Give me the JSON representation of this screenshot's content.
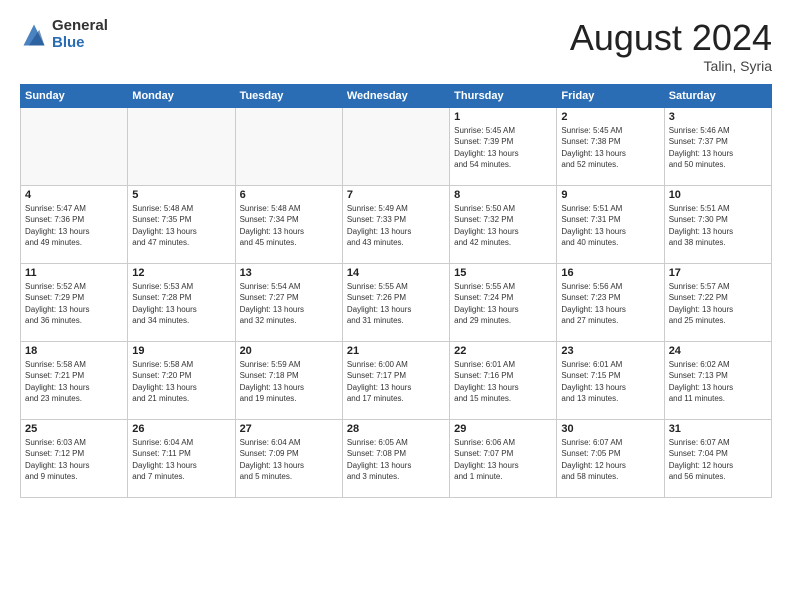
{
  "header": {
    "logo_general": "General",
    "logo_blue": "Blue",
    "month_title": "August 2024",
    "location": "Talin, Syria"
  },
  "weekdays": [
    "Sunday",
    "Monday",
    "Tuesday",
    "Wednesday",
    "Thursday",
    "Friday",
    "Saturday"
  ],
  "weeks": [
    [
      {
        "day": "",
        "info": ""
      },
      {
        "day": "",
        "info": ""
      },
      {
        "day": "",
        "info": ""
      },
      {
        "day": "",
        "info": ""
      },
      {
        "day": "1",
        "info": "Sunrise: 5:45 AM\nSunset: 7:39 PM\nDaylight: 13 hours\nand 54 minutes."
      },
      {
        "day": "2",
        "info": "Sunrise: 5:45 AM\nSunset: 7:38 PM\nDaylight: 13 hours\nand 52 minutes."
      },
      {
        "day": "3",
        "info": "Sunrise: 5:46 AM\nSunset: 7:37 PM\nDaylight: 13 hours\nand 50 minutes."
      }
    ],
    [
      {
        "day": "4",
        "info": "Sunrise: 5:47 AM\nSunset: 7:36 PM\nDaylight: 13 hours\nand 49 minutes."
      },
      {
        "day": "5",
        "info": "Sunrise: 5:48 AM\nSunset: 7:35 PM\nDaylight: 13 hours\nand 47 minutes."
      },
      {
        "day": "6",
        "info": "Sunrise: 5:48 AM\nSunset: 7:34 PM\nDaylight: 13 hours\nand 45 minutes."
      },
      {
        "day": "7",
        "info": "Sunrise: 5:49 AM\nSunset: 7:33 PM\nDaylight: 13 hours\nand 43 minutes."
      },
      {
        "day": "8",
        "info": "Sunrise: 5:50 AM\nSunset: 7:32 PM\nDaylight: 13 hours\nand 42 minutes."
      },
      {
        "day": "9",
        "info": "Sunrise: 5:51 AM\nSunset: 7:31 PM\nDaylight: 13 hours\nand 40 minutes."
      },
      {
        "day": "10",
        "info": "Sunrise: 5:51 AM\nSunset: 7:30 PM\nDaylight: 13 hours\nand 38 minutes."
      }
    ],
    [
      {
        "day": "11",
        "info": "Sunrise: 5:52 AM\nSunset: 7:29 PM\nDaylight: 13 hours\nand 36 minutes."
      },
      {
        "day": "12",
        "info": "Sunrise: 5:53 AM\nSunset: 7:28 PM\nDaylight: 13 hours\nand 34 minutes."
      },
      {
        "day": "13",
        "info": "Sunrise: 5:54 AM\nSunset: 7:27 PM\nDaylight: 13 hours\nand 32 minutes."
      },
      {
        "day": "14",
        "info": "Sunrise: 5:55 AM\nSunset: 7:26 PM\nDaylight: 13 hours\nand 31 minutes."
      },
      {
        "day": "15",
        "info": "Sunrise: 5:55 AM\nSunset: 7:24 PM\nDaylight: 13 hours\nand 29 minutes."
      },
      {
        "day": "16",
        "info": "Sunrise: 5:56 AM\nSunset: 7:23 PM\nDaylight: 13 hours\nand 27 minutes."
      },
      {
        "day": "17",
        "info": "Sunrise: 5:57 AM\nSunset: 7:22 PM\nDaylight: 13 hours\nand 25 minutes."
      }
    ],
    [
      {
        "day": "18",
        "info": "Sunrise: 5:58 AM\nSunset: 7:21 PM\nDaylight: 13 hours\nand 23 minutes."
      },
      {
        "day": "19",
        "info": "Sunrise: 5:58 AM\nSunset: 7:20 PM\nDaylight: 13 hours\nand 21 minutes."
      },
      {
        "day": "20",
        "info": "Sunrise: 5:59 AM\nSunset: 7:18 PM\nDaylight: 13 hours\nand 19 minutes."
      },
      {
        "day": "21",
        "info": "Sunrise: 6:00 AM\nSunset: 7:17 PM\nDaylight: 13 hours\nand 17 minutes."
      },
      {
        "day": "22",
        "info": "Sunrise: 6:01 AM\nSunset: 7:16 PM\nDaylight: 13 hours\nand 15 minutes."
      },
      {
        "day": "23",
        "info": "Sunrise: 6:01 AM\nSunset: 7:15 PM\nDaylight: 13 hours\nand 13 minutes."
      },
      {
        "day": "24",
        "info": "Sunrise: 6:02 AM\nSunset: 7:13 PM\nDaylight: 13 hours\nand 11 minutes."
      }
    ],
    [
      {
        "day": "25",
        "info": "Sunrise: 6:03 AM\nSunset: 7:12 PM\nDaylight: 13 hours\nand 9 minutes."
      },
      {
        "day": "26",
        "info": "Sunrise: 6:04 AM\nSunset: 7:11 PM\nDaylight: 13 hours\nand 7 minutes."
      },
      {
        "day": "27",
        "info": "Sunrise: 6:04 AM\nSunset: 7:09 PM\nDaylight: 13 hours\nand 5 minutes."
      },
      {
        "day": "28",
        "info": "Sunrise: 6:05 AM\nSunset: 7:08 PM\nDaylight: 13 hours\nand 3 minutes."
      },
      {
        "day": "29",
        "info": "Sunrise: 6:06 AM\nSunset: 7:07 PM\nDaylight: 13 hours\nand 1 minute."
      },
      {
        "day": "30",
        "info": "Sunrise: 6:07 AM\nSunset: 7:05 PM\nDaylight: 12 hours\nand 58 minutes."
      },
      {
        "day": "31",
        "info": "Sunrise: 6:07 AM\nSunset: 7:04 PM\nDaylight: 12 hours\nand 56 minutes."
      }
    ]
  ]
}
